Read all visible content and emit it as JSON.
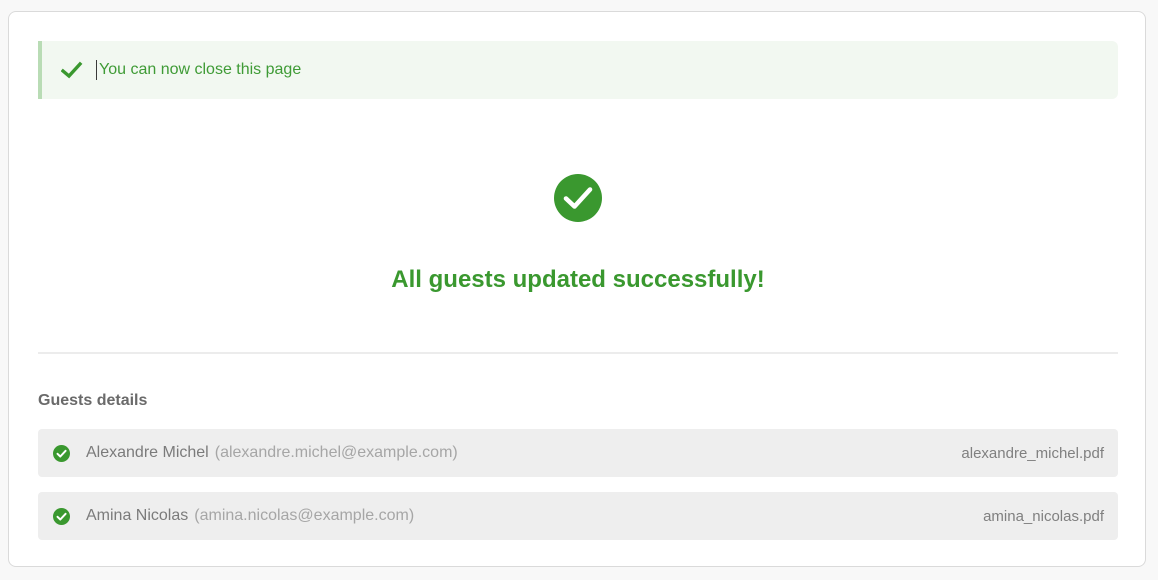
{
  "alert": {
    "message": "You can now close this page",
    "icon": "check-icon",
    "color": "#3f9b36",
    "background": "#f2f8f1"
  },
  "status": {
    "icon": "check-circle-icon",
    "title": "All guests updated successfully!",
    "color": "#3a982f"
  },
  "guests": {
    "section_title": "Guests details",
    "items": [
      {
        "name": "Alexandre Michel",
        "email": "(alexandre.michel@example.com)",
        "file": "alexandre_michel.pdf",
        "status_icon": "check-circle-icon"
      },
      {
        "name": "Amina Nicolas",
        "email": "(amina.nicolas@example.com)",
        "file": "amina_nicolas.pdf",
        "status_icon": "check-circle-icon"
      }
    ]
  }
}
